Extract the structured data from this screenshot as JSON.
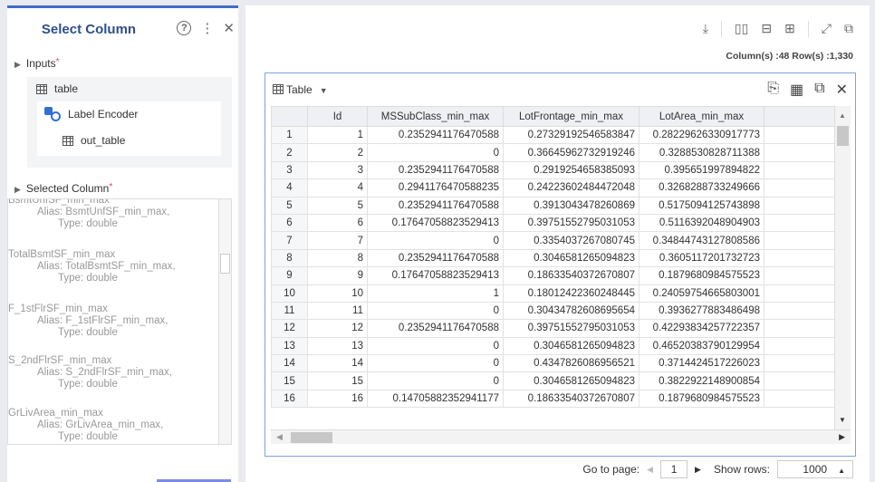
{
  "left_panel": {
    "title": "Select Column",
    "help_icon": "?",
    "more_icon": "⋮",
    "close_icon": "✕",
    "inputs_label": "Inputs",
    "required_mark": "*",
    "tree": {
      "table_label": "table",
      "encoder_label": "Label Encoder",
      "out_table_label": "out_table"
    },
    "selected_label": "Selected Column",
    "selected_columns": [
      {
        "name": "BsmtUnfSF_min_max",
        "alias": "Alias: BsmtUnfSF_min_max,",
        "type": "Type: double"
      },
      {
        "name": "TotalBsmtSF_min_max",
        "alias": "Alias: TotalBsmtSF_min_max,",
        "type": "Type: double"
      },
      {
        "name": "F_1stFlrSF_min_max",
        "alias": "Alias: F_1stFlrSF_min_max,",
        "type": "Type: double"
      },
      {
        "name": "S_2ndFlrSF_min_max",
        "alias": "Alias: S_2ndFlrSF_min_max,",
        "type": "Type: double"
      },
      {
        "name": "GrLivArea_min_max",
        "alias": "Alias: GrLivArea_min_max,",
        "type": "Type: double"
      }
    ]
  },
  "toolbar": {
    "download_icon": "⤓",
    "cols_icon": "▯▯",
    "rows_icon": "⊟",
    "grid_icon": "⊞",
    "expand_icon": "⤢",
    "popout_icon": "⧉"
  },
  "stats": {
    "text": "Column(s) :48  Row(s) :1,330"
  },
  "table": {
    "name": "Table",
    "caret": "▼",
    "tools": [
      "⎘",
      "▦",
      "⧉",
      "✕"
    ],
    "columns": [
      "",
      "Id",
      "MSSubClass_min_max",
      "LotFrontage_min_max",
      "LotArea_min_max",
      ""
    ],
    "rows": [
      [
        "1",
        "1",
        "0.2352941176470588",
        "0.27329192546583847",
        "0.28229626330917773"
      ],
      [
        "2",
        "2",
        "0",
        "0.36645962732919246",
        "0.3288530828711388"
      ],
      [
        "3",
        "3",
        "0.2352941176470588",
        "0.2919254658385093",
        "0.395651997894822"
      ],
      [
        "4",
        "4",
        "0.2941176470588235",
        "0.24223602484472048",
        "0.3268288733249666"
      ],
      [
        "5",
        "5",
        "0.2352941176470588",
        "0.3913043478260869",
        "0.5175094125743898"
      ],
      [
        "6",
        "6",
        "0.17647058823529413",
        "0.39751552795031053",
        "0.5116392048904903"
      ],
      [
        "7",
        "7",
        "0",
        "0.3354037267080745",
        "0.34844743127808586"
      ],
      [
        "8",
        "8",
        "0.2352941176470588",
        "0.3046581265094823",
        "0.3605117201732723"
      ],
      [
        "9",
        "9",
        "0.17647058823529413",
        "0.18633540372670807",
        "0.1879680984575523"
      ],
      [
        "10",
        "10",
        "1",
        "0.18012422360248445",
        "0.24059754665803001"
      ],
      [
        "11",
        "11",
        "0",
        "0.30434782608695654",
        "0.3936277883486498"
      ],
      [
        "12",
        "12",
        "0.2352941176470588",
        "0.39751552795031053",
        "0.42293834257722357"
      ],
      [
        "13",
        "13",
        "0",
        "0.3046581265094823",
        "0.46520383790129954"
      ],
      [
        "14",
        "14",
        "0",
        "0.4347826086956521",
        "0.3714424517226023"
      ],
      [
        "15",
        "15",
        "0",
        "0.3046581265094823",
        "0.3822922148900854"
      ],
      [
        "16",
        "16",
        "0.14705882352941177",
        "0.18633540372670807",
        "0.1879680984575523"
      ]
    ]
  },
  "pager": {
    "go_to_label": "Go to page:",
    "prev": "◀",
    "page": "1",
    "next": "▶",
    "show_rows_label": "Show rows:",
    "rows_value": "1000",
    "rows_caret": "▲"
  }
}
